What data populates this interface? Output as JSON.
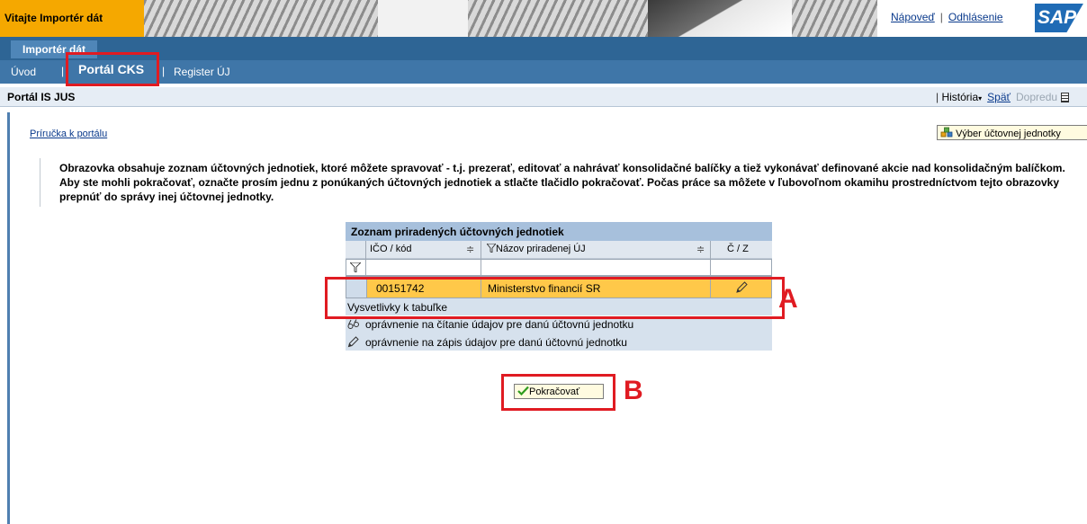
{
  "header": {
    "welcome": "Vitajte Importér dát",
    "help_link": "Nápoveď",
    "logout_link": "Odhlásenie",
    "logo": "SAP"
  },
  "nav": {
    "app_tab": "Importér dát",
    "items": [
      "Úvod",
      "Portál CKS",
      "Register ÚJ"
    ],
    "active": "Portál CKS"
  },
  "page": {
    "title": "Portál IS JUS",
    "history": "História",
    "back": "Späť",
    "forward": "Dopredu"
  },
  "links": {
    "portal_guide": "Príručka k portálu",
    "select_unit": "Výber účtovnej jednotky"
  },
  "info": {
    "text": "Obrazovka obsahuje zoznam účtovných jednotiek, ktoré môžete spravovať - t.j. prezerať, editovať a nahrávať konsolidačné balíčky a tiež vykonávať definované akcie nad konsolidačným balíčkom. Aby ste mohli pokračovať, označte prosím jednu z ponúkaných účtovných jednotiek a stlačte tlačidlo pokračovať. Počas práce sa môžete v ľubovoľnom okamihu prostredníctvom tejto obrazovky prepnúť do správy inej účtovnej jednotky."
  },
  "table": {
    "title": "Zoznam priradených účtovných jednotiek",
    "columns": [
      "IČO / kód",
      "Názov priradenej ÚJ",
      "Č / Z"
    ],
    "rows": [
      {
        "ico": "00151742",
        "name": "Ministerstvo financií SR"
      }
    ],
    "legend_title": "Vysvetlivky k tabuľke",
    "legend": [
      "oprávnenie na čítanie údajov pre danú účtovnú jednotku",
      "oprávnenie na zápis údajov pre danú účtovnú jednotku"
    ]
  },
  "buttons": {
    "continue": "Pokračovať"
  },
  "annotations": {
    "a": "A",
    "b": "B"
  },
  "colors": {
    "brand_orange": "#f5a800",
    "nav_blue": "#2e6595",
    "highlight_row": "#ffc849",
    "annotation_red": "#e01b22"
  }
}
